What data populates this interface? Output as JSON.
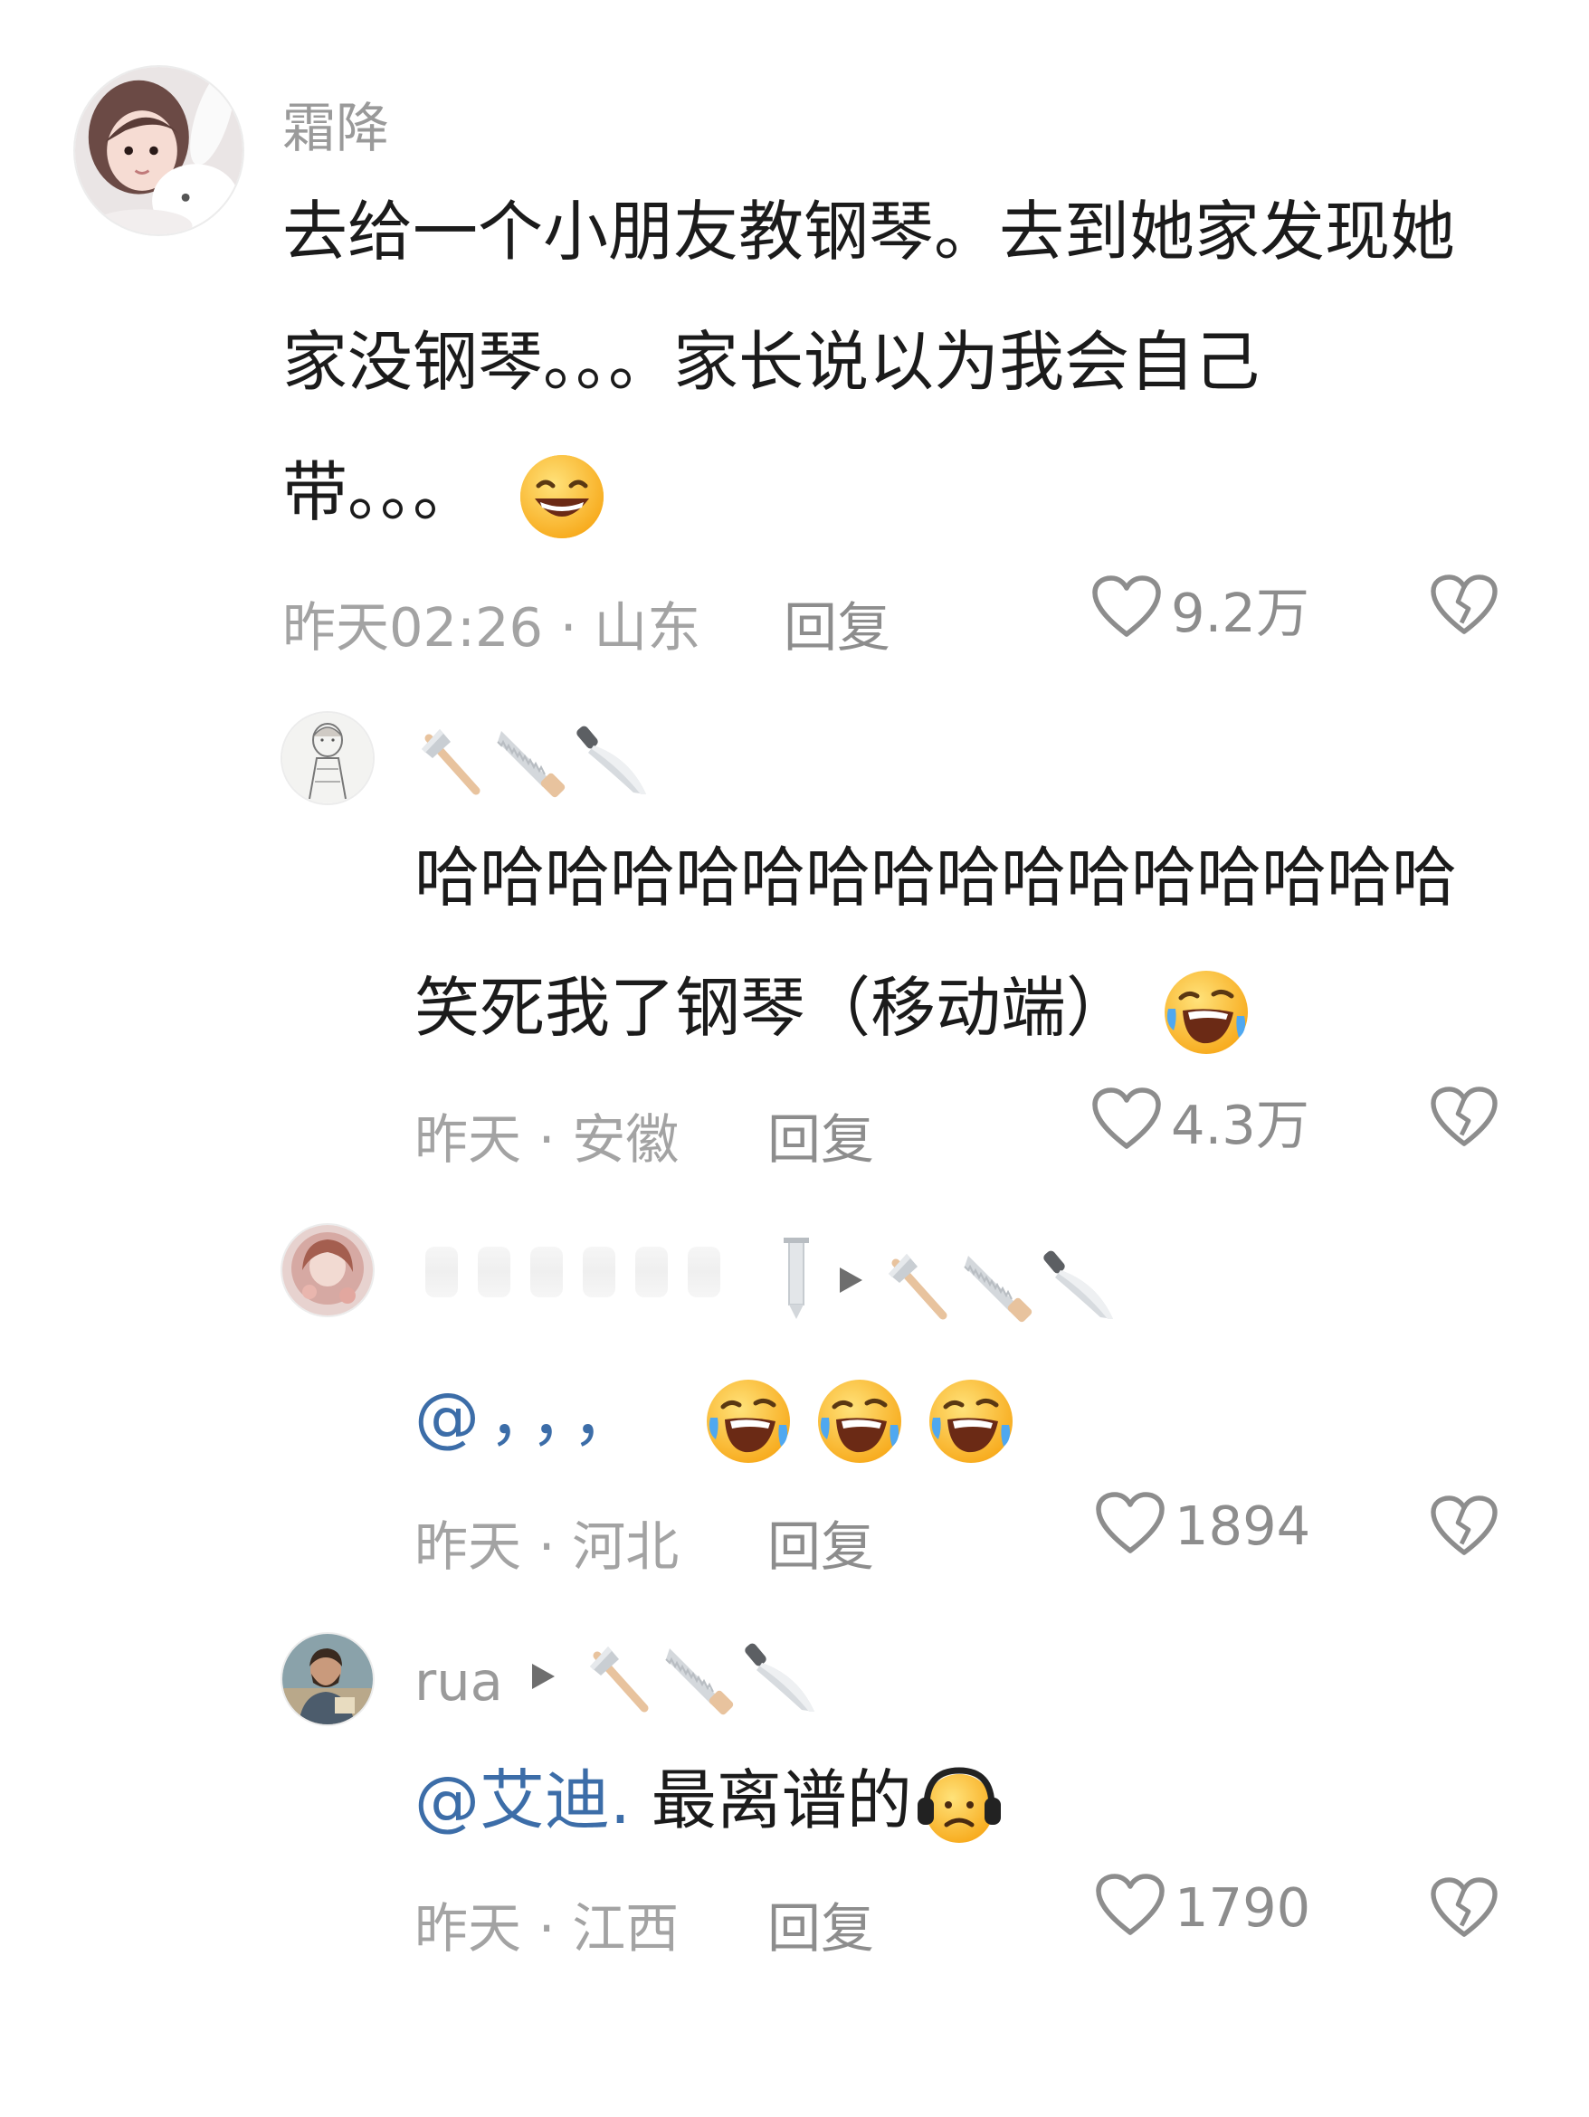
{
  "comments": [
    {
      "username": "霜降",
      "text_lines": [
        "去给一个小朋友教钢琴。去到她家发现她",
        "家没钢琴。。。家长说以为我会自己",
        "带。。。"
      ],
      "emoji_end": "grinning-sweat-face",
      "time_location": "昨天02:26 · 山东",
      "reply_label": "回复",
      "likes": "9.2万"
    },
    {
      "username_icons": [
        "axe-icon",
        "saw-icon",
        "knife-icon"
      ],
      "text_lines": [
        "哈哈哈哈哈哈哈哈哈哈哈哈哈哈哈哈",
        "笑死我了钢琴（移动端）"
      ],
      "emoji_end": "rolling-laughing-face",
      "time_location": "昨天 · 安徽",
      "reply_label": "回复",
      "likes": "4.3万"
    },
    {
      "username_icons": [
        "sword-icon",
        "play-arrow-icon",
        "axe-icon",
        "saw-icon",
        "knife-icon"
      ],
      "text": "@，，，",
      "emoji_end": "rolling-laughing-face x3",
      "time_location": "昨天 · 河北",
      "reply_label": "回复",
      "likes": "1894"
    },
    {
      "username": "rua",
      "username_icons": [
        "play-arrow-icon",
        "axe-icon",
        "saw-icon",
        "knife-icon"
      ],
      "mention": "@艾迪.",
      "text": " 最离谱的",
      "emoji_end": "headphones-frowning-face",
      "time_location": "昨天 · 江西",
      "reply_label": "回复",
      "likes": "1790"
    }
  ],
  "colors": {
    "text": "#1b1b1b",
    "meta": "#a3a3a3",
    "mention": "#3c6da8",
    "icon_gray": "#8d8d8d"
  }
}
